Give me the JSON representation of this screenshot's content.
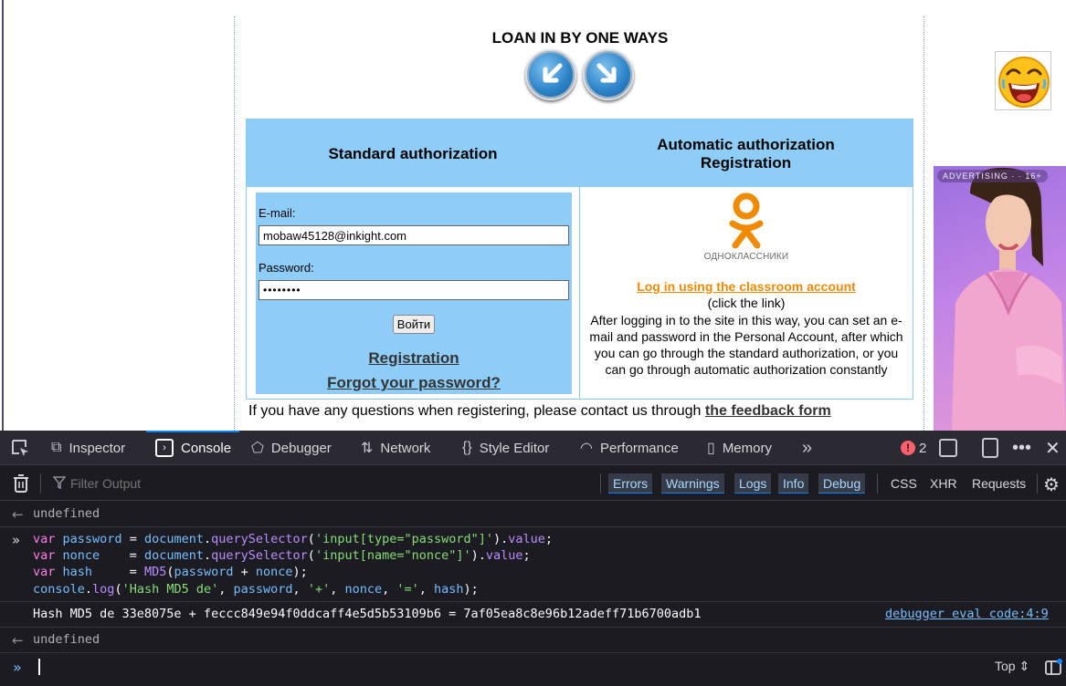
{
  "webpage": {
    "title": "LOAN IN BY ONE WAYS",
    "table": {
      "std_header": "Standard authorization",
      "auto_header_line1": "Automatic authorization",
      "auto_header_line2": "Registration"
    },
    "form": {
      "email_label": "E-mail:",
      "email_value": "mobaw45128@inkight.com",
      "password_label": "Password:",
      "password_value": "password",
      "submit_label": "Войти",
      "registration_link": "Registration",
      "forgot_link": "Forgot your password?"
    },
    "auto": {
      "logo_text": "ОДНОКЛАССНИКИ",
      "login_link": "Log in using the classroom account",
      "click_hint": "(click the link)",
      "description": "After logging in to the site in this way, you can set an e-mail and password in the Personal Account, after which you can go through the standard authorization, or you can go through automatic authorization constantly"
    },
    "feedback_text": "If you have any questions when registering, please contact us through",
    "feedback_link": "the feedback form",
    "ad_label": "ADVERTISING · · 16+",
    "colors": {
      "header_blue": "#8ecdf8",
      "ok_orange": "#f08a00"
    }
  },
  "devtools": {
    "tabs": [
      {
        "label": "Inspector",
        "icon": "inspector-icon"
      },
      {
        "label": "Console",
        "icon": "console-icon",
        "active": true
      },
      {
        "label": "Debugger",
        "icon": "debugger-icon"
      },
      {
        "label": "Network",
        "icon": "network-icon"
      },
      {
        "label": "Style Editor",
        "icon": "style-editor-icon"
      },
      {
        "label": "Performance",
        "icon": "performance-icon"
      },
      {
        "label": "Memory",
        "icon": "memory-icon"
      }
    ],
    "error_count": "2",
    "filter_placeholder": "Filter Output",
    "levels": [
      "Errors",
      "Warnings",
      "Logs",
      "Info",
      "Debug"
    ],
    "request_filters": [
      "CSS",
      "XHR",
      "Requests"
    ],
    "console": {
      "result1": "undefined",
      "code": {
        "l1": {
          "a": "var",
          "b": "password",
          "c": " = ",
          "d": "document",
          "e": ".",
          "f": "querySelector",
          "g": "(",
          "h": "'input[type=\"password\"]'",
          "i": ").",
          "j": "value",
          "k": ";"
        },
        "l2": {
          "a": "var",
          "b": "nonce",
          "c": "    = ",
          "d": "document",
          "e": ".",
          "f": "querySelector",
          "g": "(",
          "h": "'input[name=\"nonce\"]'",
          "i": ").",
          "j": "value",
          "k": ";"
        },
        "l3": {
          "a": "var",
          "b": "hash",
          "c": "     = ",
          "d": "MD5",
          "e": "(",
          "f": "password",
          "g": " + ",
          "h": "nonce",
          "i": ");"
        },
        "l4": {
          "a": "console",
          "b": ".",
          "c": "log",
          "d": "(",
          "e": "'Hash MD5 de'",
          "f": ", ",
          "g": "password",
          "h": ", ",
          "i": "'+'",
          "j": ", ",
          "k": "nonce",
          "l": ", ",
          "m": "'='",
          "n": ", ",
          "o": "hash",
          "p": ");"
        }
      },
      "log_output": "Hash MD5 de 33e8075e + feccc849e94f0ddcaff4e5d5b53109b6 = 7af05ea8c8e96b12adeff71b6700adb1",
      "log_source": "debugger eval code:4:9",
      "result2": "undefined"
    },
    "context": "Top ⇕"
  }
}
